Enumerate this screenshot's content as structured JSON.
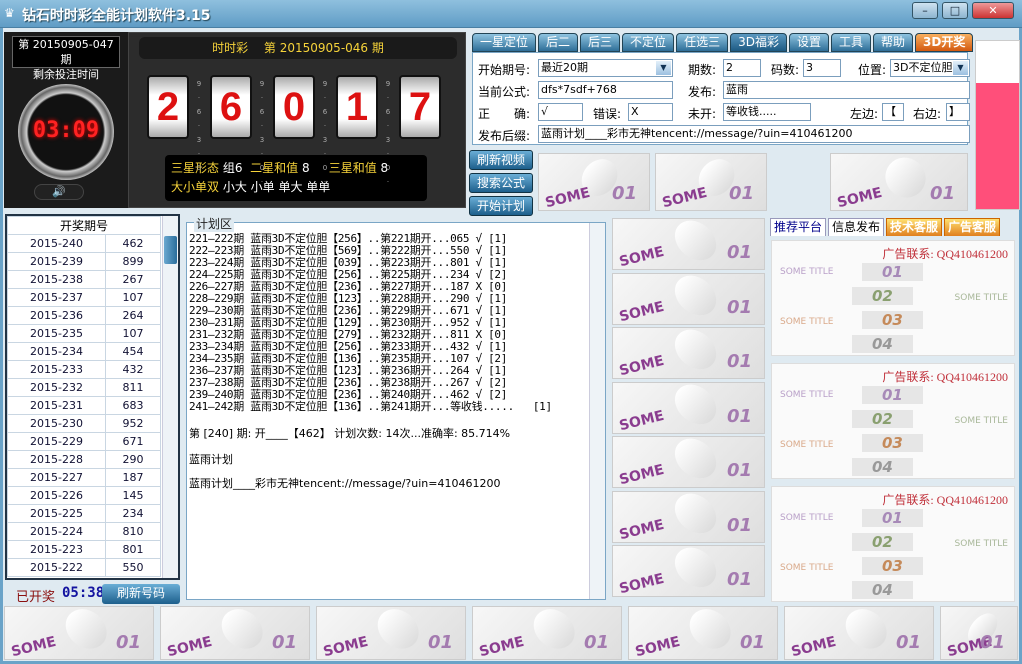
{
  "window": {
    "title": "钻石时时彩全能计划软件3.15",
    "controls": [
      "–",
      "□",
      "✕"
    ]
  },
  "timer": {
    "next_issue": "第 20150905-047 期",
    "remaining_label": "剩余投注时间",
    "countdown": "03:09",
    "speaker_icon": "speaker-icon"
  },
  "draw": {
    "header": "时时彩　 第 20150905-046 期",
    "digits": [
      "2",
      "6",
      "0",
      "1",
      "7"
    ],
    "scale": [
      "9",
      "6",
      "3",
      "0"
    ],
    "info": {
      "shape_label": "三星形态",
      "shape_value": "组6",
      "sum2_label": "二星和值",
      "sum2_value": "8",
      "sum3_label": "三星和值",
      "sum3_value": "8",
      "bsoe_label": "大小单双",
      "bsoe_value": "小大 小单 单大 单单"
    }
  },
  "tabs": [
    {
      "label": "一星定位"
    },
    {
      "label": "后二"
    },
    {
      "label": "后三"
    },
    {
      "label": "不定位"
    },
    {
      "label": "任选三"
    },
    {
      "label": "3D福彩",
      "active": true
    },
    {
      "label": "设置"
    },
    {
      "label": "工具"
    },
    {
      "label": "帮助"
    },
    {
      "label": "3D开奖"
    }
  ],
  "form": {
    "start_label": "开始期号:",
    "start_value": "最近20期",
    "periods_label": "期数:",
    "periods_value": "2",
    "codes_label": "码数:",
    "codes_value": "3",
    "position_label": "位置:",
    "position_value": "3D不定位胆",
    "formula_label": "当前公式:",
    "formula_value": "dfs*7sdf+768",
    "publish_label": "发布:",
    "publish_value": "蓝雨",
    "correct_label": "正　　确:",
    "correct_value": "√",
    "wrong_label": "错误:",
    "wrong_value": "X",
    "pending_label": "未开:",
    "pending_value": "等收钱.....",
    "left_label": "左边:",
    "left_value": "【",
    "right_label": "右边:",
    "right_value": "】",
    "suffix_label": "发布后缀:",
    "suffix_value": "蓝雨计划____彩市无神tencent://message/?uin=410461200"
  },
  "side_buttons": [
    "刷新视频",
    "搜索公式",
    "开始计划"
  ],
  "tile": {
    "word": "SOME",
    "number": "01"
  },
  "history": {
    "header": "开奖期号",
    "rows": [
      [
        "2015-240",
        "462"
      ],
      [
        "2015-239",
        "899"
      ],
      [
        "2015-238",
        "267"
      ],
      [
        "2015-237",
        "107"
      ],
      [
        "2015-236",
        "264"
      ],
      [
        "2015-235",
        "107"
      ],
      [
        "2015-234",
        "454"
      ],
      [
        "2015-233",
        "432"
      ],
      [
        "2015-232",
        "811"
      ],
      [
        "2015-231",
        "683"
      ],
      [
        "2015-230",
        "952"
      ],
      [
        "2015-229",
        "671"
      ],
      [
        "2015-228",
        "290"
      ],
      [
        "2015-227",
        "187"
      ],
      [
        "2015-226",
        "145"
      ],
      [
        "2015-225",
        "234"
      ],
      [
        "2015-224",
        "810"
      ],
      [
        "2015-223",
        "801"
      ],
      [
        "2015-222",
        "550"
      ]
    ],
    "opened_label": "已开奖",
    "opened_time": "05:38",
    "refresh_label": "刷新号码"
  },
  "plan": {
    "legend": "计划区",
    "lines": [
      "221—222期 蓝雨3D不定位胆【256】..第221期开...065 √ [1]",
      "222—223期 蓝雨3D不定位胆【569】..第222期开...550 √ [1]",
      "223—224期 蓝雨3D不定位胆【039】..第223期开...801 √ [1]",
      "224—225期 蓝雨3D不定位胆【256】..第225期开...234 √ [2]",
      "226—227期 蓝雨3D不定位胆【236】..第227期开...187 X [0]",
      "228—229期 蓝雨3D不定位胆【123】..第228期开...290 √ [1]",
      "229—230期 蓝雨3D不定位胆【236】..第229期开...671 √ [1]",
      "230—231期 蓝雨3D不定位胆【129】..第230期开...952 √ [1]",
      "231—232期 蓝雨3D不定位胆【279】..第232期开...811 X [0]",
      "233—234期 蓝雨3D不定位胆【256】..第233期开...432 √ [1]",
      "234—235期 蓝雨3D不定位胆【136】..第235期开...107 √ [2]",
      "236—237期 蓝雨3D不定位胆【123】..第236期开...264 √ [1]",
      "237—238期 蓝雨3D不定位胆【236】..第238期开...267 √ [2]",
      "239—240期 蓝雨3D不定位胆【236】..第240期开...462 √ [2]",
      "241—242期 蓝雨3D不定位胆【136】..第241期开...等收钱.....   [1]"
    ],
    "summary": "第 [240] 期: 开____【462】 计划次数: 14次...准确率: 85.714%",
    "name": "蓝雨计划",
    "footer": "蓝雨计划____彩市无神tencent://message/?uin=410461200"
  },
  "right_tabs": [
    {
      "label": "推荐平台"
    },
    {
      "label": "信息发布"
    },
    {
      "label": "技术客服"
    },
    {
      "label": "广告客服"
    }
  ],
  "ad": {
    "contact": "广告联系: QQ410461200",
    "title": "SOME TITLE",
    "numbers": [
      "01",
      "02",
      "03",
      "04"
    ]
  },
  "colors": {
    "titlebar": "#5f9cc5",
    "digit": "#dd1111",
    "accent_yellow": "#f6d33a",
    "pink": "#ff4f7a"
  }
}
